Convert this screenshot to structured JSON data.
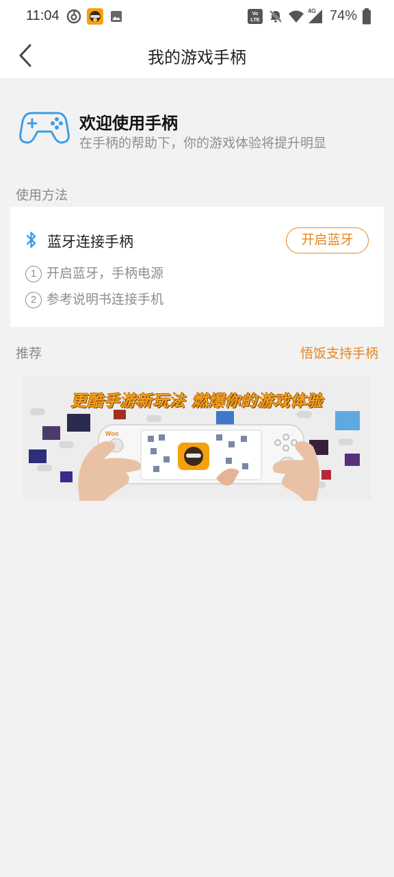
{
  "status_bar": {
    "time": "11:04",
    "battery": "74%",
    "network_type": "4G",
    "volte_label": "VoLTE",
    "icons": [
      "netease-music-icon",
      "app-avatar-icon",
      "gallery-icon",
      "volte-icon",
      "mute-bell-icon",
      "wifi-icon",
      "signal-icon",
      "battery-icon"
    ]
  },
  "app_bar": {
    "back_icon": "chevron-left-icon",
    "title": "我的游戏手柄"
  },
  "welcome": {
    "icon": "gamepad-icon",
    "title": "欢迎使用手柄",
    "subtitle": "在手柄的帮助下，你的游戏体验将提升明显"
  },
  "usage": {
    "section_label": "使用方法",
    "bt_icon": "bluetooth-icon",
    "title": "蓝牙连接手柄",
    "button_label": "开启蓝牙",
    "steps": [
      {
        "num": "1",
        "text": "开启蓝牙，手柄电源"
      },
      {
        "num": "2",
        "text": "参考说明书连接手机"
      }
    ]
  },
  "recommend": {
    "section_label": "推荐",
    "link_label": "悟饭支持手柄",
    "banner_headline": "更酷手游新玩法 燃爆你的游戏体验"
  },
  "colors": {
    "accent_orange": "#e5851d",
    "icon_blue": "#3a9ee8",
    "background": "#f2f2f2"
  }
}
